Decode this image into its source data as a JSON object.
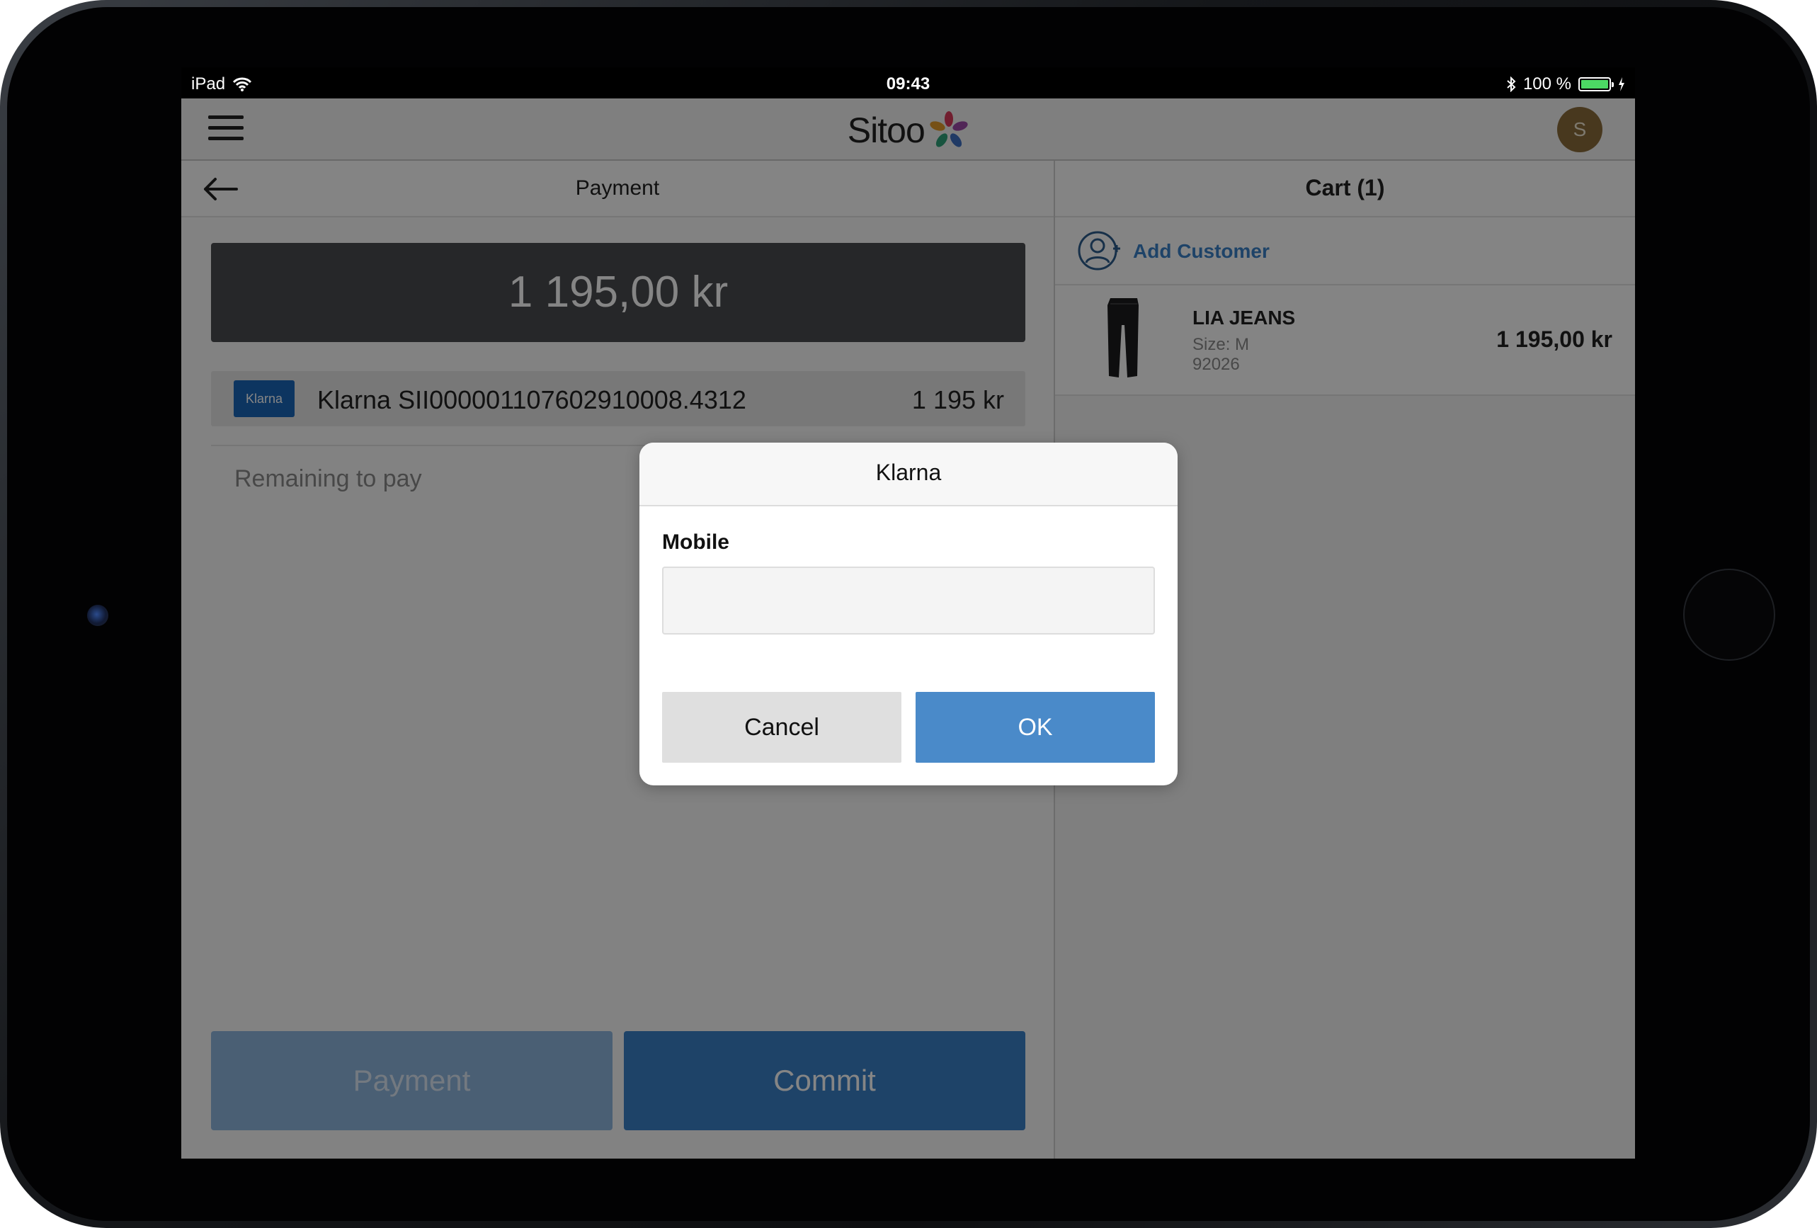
{
  "status_bar": {
    "device": "iPad",
    "time": "09:43",
    "battery_text": "100 %",
    "battery_level": 1.0
  },
  "app_bar": {
    "logo_text": "Sitoo",
    "avatar_initial": "S"
  },
  "payment_pane": {
    "title": "Payment",
    "total_amount": "1 195,00 kr",
    "payment_line": {
      "method_logo": "Klarna",
      "name": "Klarna SII00000110760291​0008.4312",
      "amount": "1 195 kr"
    },
    "remaining_label": "Remaining to pay",
    "payment_button": "Payment",
    "commit_button": "Commit"
  },
  "cart_pane": {
    "title": "Cart (1)",
    "add_customer": "Add Customer",
    "items": [
      {
        "name": "LIA JEANS",
        "size": "Size: M",
        "code": "92026",
        "price": "1 195,00 kr"
      }
    ]
  },
  "dialog": {
    "title": "Klarna",
    "field_label": "Mobile",
    "field_value": "",
    "field_placeholder": "",
    "cancel_label": "Cancel",
    "ok_label": "OK"
  },
  "colors": {
    "accent": "#3a80c7",
    "dialog_ok": "#4a8ac9",
    "amount_box": "#4a4c50",
    "klarna_logo_bg": "#1a66b8"
  }
}
